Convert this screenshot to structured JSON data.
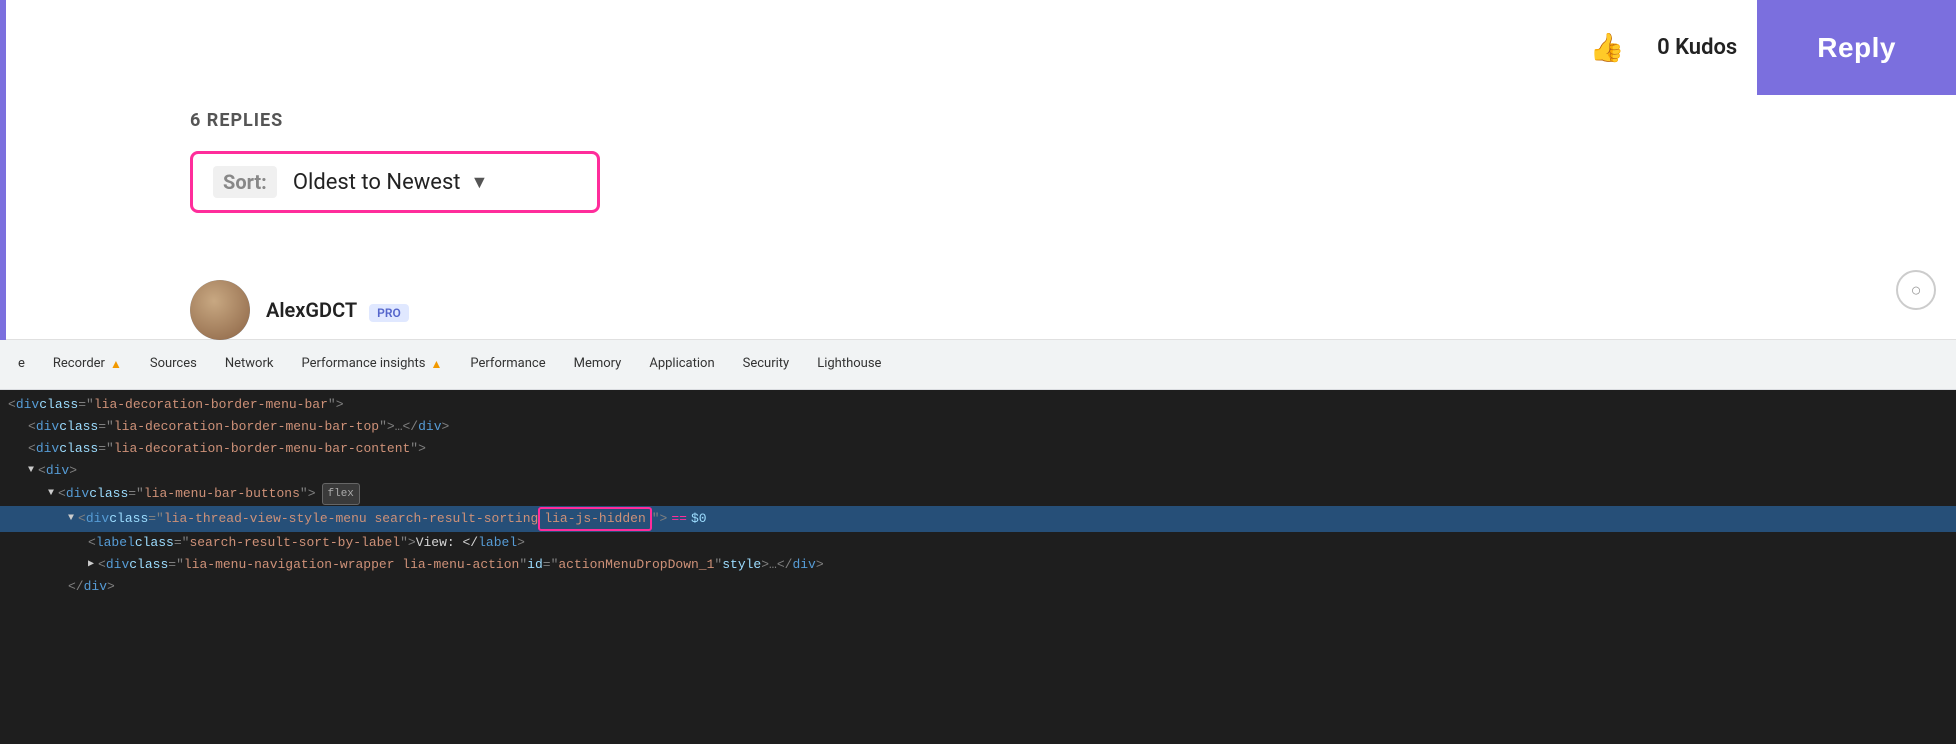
{
  "kudos": {
    "count_label": "0 Kudos",
    "thumbs_icon": "👍",
    "reply_label": "Reply"
  },
  "replies": {
    "section_label": "6 REPLIES",
    "sort_label": "Sort:",
    "sort_value": "Oldest to Newest",
    "sort_arrow": "▼"
  },
  "user": {
    "name": "AlexGDCT",
    "badge": "PRO"
  },
  "devtools": {
    "tabs": [
      {
        "label": "e",
        "has_icon": false
      },
      {
        "label": "Recorder",
        "has_icon": true
      },
      {
        "label": "Sources",
        "has_icon": false
      },
      {
        "label": "Network",
        "has_icon": false
      },
      {
        "label": "Performance insights",
        "has_icon": true
      },
      {
        "label": "Performance",
        "has_icon": false
      },
      {
        "label": "Memory",
        "has_icon": false
      },
      {
        "label": "Application",
        "has_icon": false
      },
      {
        "label": "Security",
        "has_icon": false
      },
      {
        "label": "Lighthouse",
        "has_icon": false
      }
    ],
    "code_lines": [
      {
        "id": 1,
        "indent": 0,
        "content": "div_class_lia-decoration-border-menu-bar",
        "highlighted": false
      },
      {
        "id": 2,
        "indent": 1,
        "content": "div_class_lia-decoration-border-menu-bar-top",
        "highlighted": false
      },
      {
        "id": 3,
        "indent": 1,
        "content": "div_class_lia-decoration-border-menu-bar-content",
        "highlighted": false
      },
      {
        "id": 4,
        "indent": 1,
        "content": "div",
        "highlighted": false
      },
      {
        "id": 5,
        "indent": 2,
        "content": "div_class_lia-menu-bar-buttons_flex",
        "highlighted": false
      },
      {
        "id": 6,
        "indent": 3,
        "content": "div_class_lia-thread-view-style-menu_highlighted",
        "highlighted": true
      },
      {
        "id": 7,
        "indent": 4,
        "content": "label_class_search-result-sort-by-label",
        "highlighted": false
      },
      {
        "id": 8,
        "indent": 4,
        "content": "div_class_lia-menu-navigation-wrapper",
        "highlighted": false
      },
      {
        "id": 9,
        "indent": 3,
        "content": "div_close",
        "highlighted": false
      }
    ],
    "flex_badge": "flex",
    "equals": "==",
    "dollar_var": "$0"
  }
}
